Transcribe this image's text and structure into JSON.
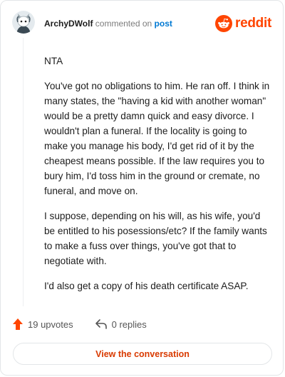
{
  "comment": {
    "author": "ArchyDWolf",
    "action_text": "commented on",
    "target_link": "post",
    "brand": "reddit",
    "paragraphs": [
      "NTA",
      "You've got no obligations to him. He ran off. I think in many states, the \"having a kid with another woman\" would be a pretty damn quick and easy divorce. I wouldn't plan a funeral. If the locality is going to make you manage his body, I'd get rid of it by the cheapest means possible. If the law requires you to bury him, I'd toss him in the ground or cremate, no funeral, and move on.",
      "I suppose, depending on his will, as his wife, you'd be entitled to his posessions/etc? If the family wants to make a fuss over things, you've got that to negotiate with.",
      "I'd also get a copy of his death certificate ASAP."
    ],
    "upvotes": "19 upvotes",
    "replies": "0 replies",
    "view_button": "View the conversation"
  },
  "colors": {
    "brand_orange": "#ff4500",
    "link_blue": "#0079d3",
    "button_text": "#d93a00",
    "upvote_arrow": "#ff4500"
  },
  "icons": {
    "avatar": "snoo-avatar",
    "brand": "reddit-snoo-logo-icon",
    "upvote": "upvote-arrow-icon",
    "reply": "reply-arrow-icon"
  }
}
